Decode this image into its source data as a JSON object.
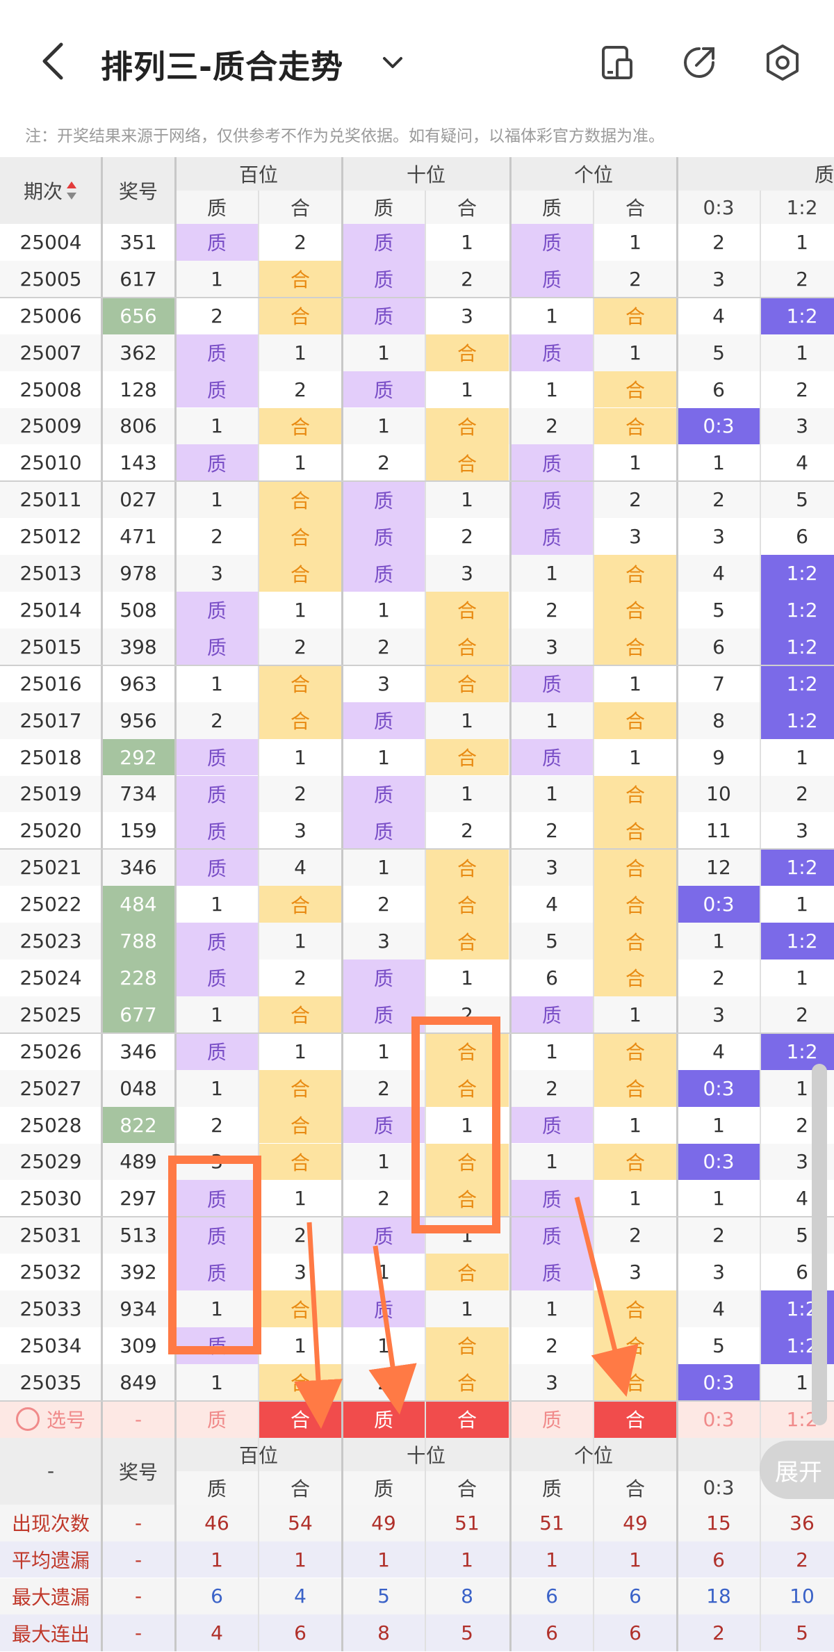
{
  "header": {
    "title": "排列三-质合走势",
    "notice": "注：开奖结果来源于网络，仅供参考不作为兑奖依据。如有疑问，以福体彩官方数据为准。"
  },
  "columns": {
    "period": "期次",
    "number": "奖号",
    "groups": [
      "百位",
      "十位",
      "个位",
      "质"
    ],
    "sub": [
      "质",
      "合",
      "质",
      "合",
      "质",
      "合",
      "0:3",
      "1:2"
    ]
  },
  "rows": [
    {
      "period": "25004",
      "num": "351",
      "hl": false,
      "c": [
        "质",
        "2",
        "质",
        "1",
        "质",
        "1",
        "2",
        "1"
      ]
    },
    {
      "period": "25005",
      "num": "617",
      "hl": false,
      "c": [
        "1",
        "合",
        "质",
        "2",
        "质",
        "2",
        "3",
        "2"
      ]
    },
    {
      "period": "25006",
      "num": "656",
      "hl": true,
      "c": [
        "2",
        "合",
        "质",
        "3",
        "1",
        "合",
        "4",
        "1:2"
      ]
    },
    {
      "period": "25007",
      "num": "362",
      "hl": false,
      "c": [
        "质",
        "1",
        "1",
        "合",
        "质",
        "1",
        "5",
        "1"
      ]
    },
    {
      "period": "25008",
      "num": "128",
      "hl": false,
      "c": [
        "质",
        "2",
        "质",
        "1",
        "1",
        "合",
        "6",
        "2"
      ]
    },
    {
      "period": "25009",
      "num": "806",
      "hl": false,
      "c": [
        "1",
        "合",
        "1",
        "合",
        "2",
        "合",
        "0:3",
        "3"
      ]
    },
    {
      "period": "25010",
      "num": "143",
      "hl": false,
      "c": [
        "质",
        "1",
        "2",
        "合",
        "质",
        "1",
        "1",
        "4"
      ]
    },
    {
      "period": "25011",
      "num": "027",
      "hl": false,
      "c": [
        "1",
        "合",
        "质",
        "1",
        "质",
        "2",
        "2",
        "5"
      ]
    },
    {
      "period": "25012",
      "num": "471",
      "hl": false,
      "c": [
        "2",
        "合",
        "质",
        "2",
        "质",
        "3",
        "3",
        "6"
      ]
    },
    {
      "period": "25013",
      "num": "978",
      "hl": false,
      "c": [
        "3",
        "合",
        "质",
        "3",
        "1",
        "合",
        "4",
        "1:2"
      ]
    },
    {
      "period": "25014",
      "num": "508",
      "hl": false,
      "c": [
        "质",
        "1",
        "1",
        "合",
        "2",
        "合",
        "5",
        "1:2"
      ]
    },
    {
      "period": "25015",
      "num": "398",
      "hl": false,
      "c": [
        "质",
        "2",
        "2",
        "合",
        "3",
        "合",
        "6",
        "1:2"
      ]
    },
    {
      "period": "25016",
      "num": "963",
      "hl": false,
      "c": [
        "1",
        "合",
        "3",
        "合",
        "质",
        "1",
        "7",
        "1:2"
      ]
    },
    {
      "period": "25017",
      "num": "956",
      "hl": false,
      "c": [
        "2",
        "合",
        "质",
        "1",
        "1",
        "合",
        "8",
        "1:2"
      ]
    },
    {
      "period": "25018",
      "num": "292",
      "hl": true,
      "c": [
        "质",
        "1",
        "1",
        "合",
        "质",
        "1",
        "9",
        "1"
      ]
    },
    {
      "period": "25019",
      "num": "734",
      "hl": false,
      "c": [
        "质",
        "2",
        "质",
        "1",
        "1",
        "合",
        "10",
        "2"
      ]
    },
    {
      "period": "25020",
      "num": "159",
      "hl": false,
      "c": [
        "质",
        "3",
        "质",
        "2",
        "2",
        "合",
        "11",
        "3"
      ]
    },
    {
      "period": "25021",
      "num": "346",
      "hl": false,
      "c": [
        "质",
        "4",
        "1",
        "合",
        "3",
        "合",
        "12",
        "1:2"
      ]
    },
    {
      "period": "25022",
      "num": "484",
      "hl": true,
      "c": [
        "1",
        "合",
        "2",
        "合",
        "4",
        "合",
        "0:3",
        "1"
      ]
    },
    {
      "period": "25023",
      "num": "788",
      "hl": true,
      "c": [
        "质",
        "1",
        "3",
        "合",
        "5",
        "合",
        "1",
        "1:2"
      ]
    },
    {
      "period": "25024",
      "num": "228",
      "hl": true,
      "c": [
        "质",
        "2",
        "质",
        "1",
        "6",
        "合",
        "2",
        "1"
      ]
    },
    {
      "period": "25025",
      "num": "677",
      "hl": true,
      "c": [
        "1",
        "合",
        "质",
        "2",
        "质",
        "1",
        "3",
        "2"
      ]
    },
    {
      "period": "25026",
      "num": "346",
      "hl": false,
      "c": [
        "质",
        "1",
        "1",
        "合",
        "1",
        "合",
        "4",
        "1:2"
      ]
    },
    {
      "period": "25027",
      "num": "048",
      "hl": false,
      "c": [
        "1",
        "合",
        "2",
        "合",
        "2",
        "合",
        "0:3",
        "1"
      ]
    },
    {
      "period": "25028",
      "num": "822",
      "hl": true,
      "c": [
        "2",
        "合",
        "质",
        "1",
        "质",
        "1",
        "1",
        "2"
      ]
    },
    {
      "period": "25029",
      "num": "489",
      "hl": false,
      "c": [
        "3",
        "合",
        "1",
        "合",
        "1",
        "合",
        "0:3",
        "3"
      ]
    },
    {
      "period": "25030",
      "num": "297",
      "hl": false,
      "c": [
        "质",
        "1",
        "2",
        "合",
        "质",
        "1",
        "1",
        "4"
      ]
    },
    {
      "period": "25031",
      "num": "513",
      "hl": false,
      "c": [
        "质",
        "2",
        "质",
        "1",
        "质",
        "2",
        "2",
        "5"
      ]
    },
    {
      "period": "25032",
      "num": "392",
      "hl": false,
      "c": [
        "质",
        "3",
        "1",
        "合",
        "质",
        "3",
        "3",
        "6"
      ]
    },
    {
      "period": "25033",
      "num": "934",
      "hl": false,
      "c": [
        "1",
        "合",
        "质",
        "1",
        "1",
        "合",
        "4",
        "1:2"
      ]
    },
    {
      "period": "25034",
      "num": "309",
      "hl": false,
      "c": [
        "质",
        "1",
        "1",
        "合",
        "2",
        "合",
        "5",
        "1:2"
      ]
    },
    {
      "period": "25035",
      "num": "849",
      "hl": false,
      "c": [
        "1",
        "合",
        "2",
        "合",
        "3",
        "合",
        "0:3",
        "1"
      ]
    }
  ],
  "select_row": {
    "label": "选号",
    "num": "-",
    "cells": [
      "质",
      "合",
      "质",
      "合",
      "质",
      "合",
      "0:3",
      "1:2"
    ],
    "selected": [
      false,
      true,
      true,
      true,
      false,
      true,
      false,
      false
    ]
  },
  "footer_header": {
    "dash": "-",
    "number": "奖号",
    "groups": [
      "百位",
      "十位",
      "个位"
    ],
    "sub": [
      "质",
      "合",
      "质",
      "合",
      "质",
      "合",
      "0:3",
      ""
    ]
  },
  "stats": [
    {
      "label": "出现次数",
      "dash": "-",
      "values": [
        "46",
        "54",
        "49",
        "51",
        "51",
        "49",
        "15",
        "36"
      ],
      "tone": "red"
    },
    {
      "label": "平均遗漏",
      "dash": "-",
      "values": [
        "1",
        "1",
        "1",
        "1",
        "1",
        "1",
        "6",
        "2"
      ],
      "tone": "red"
    },
    {
      "label": "最大遗漏",
      "dash": "-",
      "values": [
        "6",
        "4",
        "5",
        "8",
        "6",
        "6",
        "18",
        "10"
      ],
      "tone": "blue"
    },
    {
      "label": "最大连出",
      "dash": "-",
      "values": [
        "4",
        "6",
        "8",
        "5",
        "6",
        "6",
        "2",
        "5"
      ],
      "tone": "red"
    }
  ],
  "expand_label": "展开",
  "colors": {
    "prime_bg": "#e3cdfa",
    "composite_bg": "#fde3a0",
    "ratio_hit": "#7b6ae8",
    "highlight_num": "#a6c4a0",
    "selected_red": "#f14c4c",
    "annotation": "#ff7a45"
  },
  "icons": [
    "back-arrow-icon",
    "chevron-down-icon",
    "phone-tablet-icon",
    "share-icon",
    "settings-icon",
    "sort-icon",
    "radio-icon"
  ]
}
